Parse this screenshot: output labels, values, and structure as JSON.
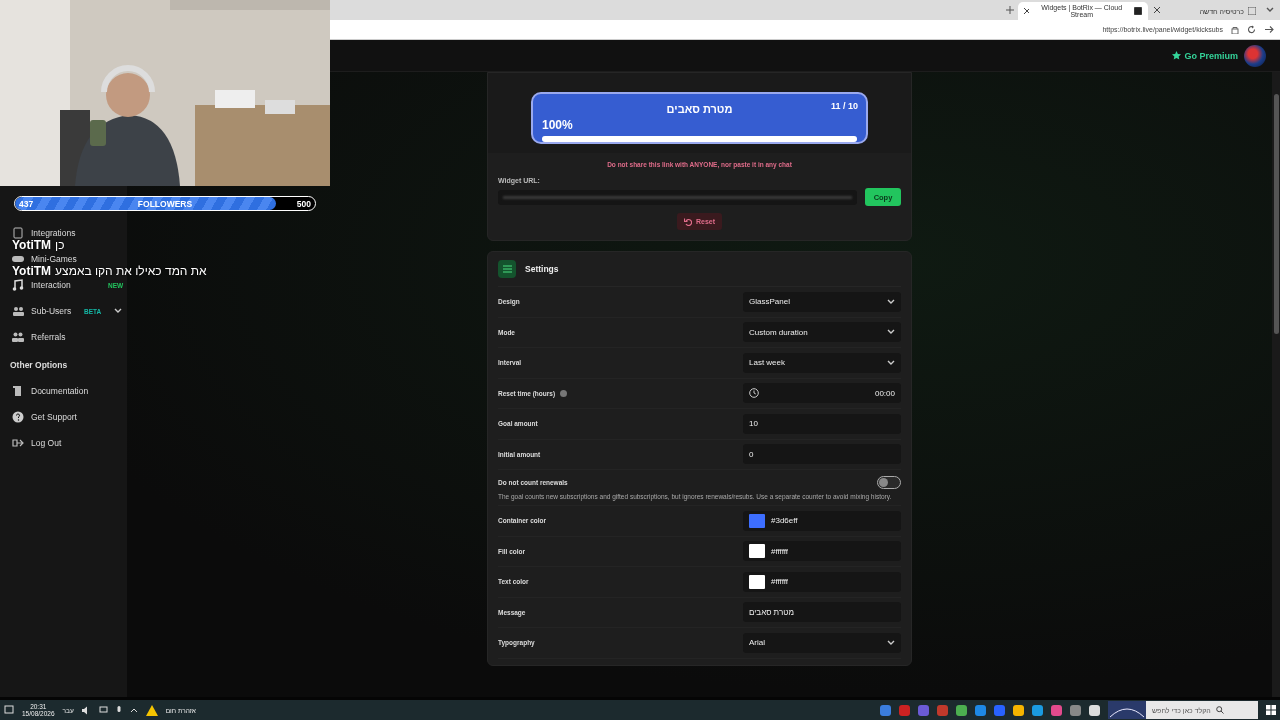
{
  "browser": {
    "tabs": [
      {
        "label": "Widgets | BotRix — Cloud Stream",
        "selected": true
      },
      {
        "label": "כרטיסיה חדשה",
        "selected": false
      }
    ],
    "url": "https://botrix.live/panel/widget/kicksubs"
  },
  "topbar": {
    "premium": "Go Premium"
  },
  "sidebar": {
    "items": [
      {
        "label": "Integrations"
      },
      {
        "label": "Mini-Games"
      },
      {
        "label": "Interaction",
        "badge": {
          "text": "NEW",
          "color": "#22c55e"
        }
      },
      {
        "label": "Sub-Users",
        "badge": {
          "text": "BETA",
          "color": "#14b8a6"
        },
        "expanded": false
      },
      {
        "label": "Referrals"
      }
    ],
    "section": "Other Options",
    "other_items": [
      {
        "label": "Documentation"
      },
      {
        "label": "Get Support"
      },
      {
        "label": "Log Out"
      }
    ]
  },
  "widget_preview": {
    "title": "מטרת סאבים",
    "count": "11 / 10",
    "percent": "100%",
    "level": 1
  },
  "warning": "Do not share this link with ANYONE, nor paste it in any chat",
  "widget_url": {
    "label": "Widget URL:",
    "copy": "Copy"
  },
  "reset": "Reset",
  "settings": {
    "title": "Settings",
    "rows": [
      {
        "kind": "select",
        "label": "Design",
        "value": "GlassPanel"
      },
      {
        "kind": "select",
        "label": "Mode",
        "value": "Custom duration"
      },
      {
        "kind": "select",
        "label": "Interval",
        "value": "Last week"
      },
      {
        "kind": "time",
        "label": "Reset time (hours)",
        "value": "00:00",
        "hint": true
      },
      {
        "kind": "text",
        "label": "Goal amount",
        "value": "10"
      },
      {
        "kind": "text",
        "label": "Initial amount",
        "value": "0"
      },
      {
        "kind": "toggle",
        "label": "Do not count renewals",
        "on": false,
        "description": "The goal counts new subscriptions and gifted subscriptions, but ignores renewals/resubs. Use a separate counter to avoid mixing history."
      },
      {
        "kind": "color",
        "label": "Container color",
        "value": "#3d6eff",
        "color": "#3d6eff"
      },
      {
        "kind": "color",
        "label": "Fill color",
        "value": "#ffffff",
        "color": "#ffffff"
      },
      {
        "kind": "color",
        "label": "Text color",
        "value": "#ffffff",
        "color": "#ffffff"
      },
      {
        "kind": "text",
        "label": "Message",
        "value": "מטרת סאבים"
      },
      {
        "kind": "select",
        "label": "Typography",
        "value": "Arial"
      }
    ]
  },
  "overlay": {
    "followers": {
      "current": "437",
      "label": "FOLLOWERS",
      "goal": "500",
      "level": 0.87
    },
    "chat": [
      {
        "user": "YotiTM",
        "text": "כן"
      },
      {
        "user": "YotiTM",
        "text": "את המד כאילו את הקו באמצע"
      }
    ]
  },
  "taskbar": {
    "time": "20:31",
    "date": "15/08/2026",
    "language": "עבר",
    "weather": "אזהרת חום",
    "search": {
      "placeholder": "הקלד כאן כדי לחפש"
    }
  }
}
